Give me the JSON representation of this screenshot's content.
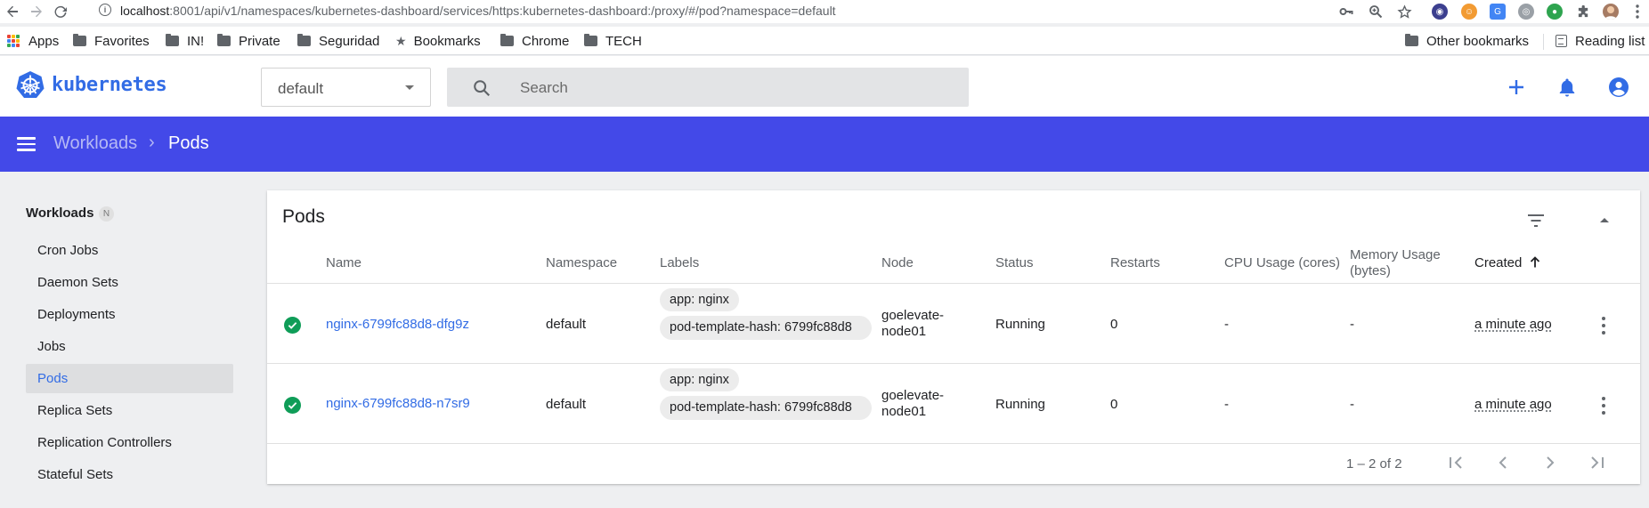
{
  "browser": {
    "url_host": "localhost",
    "url_rest": ":8001/api/v1/namespaces/kubernetes-dashboard/services/https:kubernetes-dashboard:/proxy/#/pod?namespace=default",
    "bookmarks": [
      "Apps",
      "Favorites",
      "IN!",
      "Private",
      "Seguridad",
      "Bookmarks",
      "Chrome",
      "TECH"
    ],
    "other_bookmarks": "Other bookmarks",
    "reading_list": "Reading list"
  },
  "app": {
    "logo_text": "kubernetes",
    "namespace": "default",
    "search_placeholder": "Search",
    "brand_color": "#326ce5",
    "header_color": "#4349e8"
  },
  "breadcrumb": {
    "parent": "Workloads",
    "separator": "›",
    "current": "Pods"
  },
  "sidebar": {
    "section_title": "Workloads",
    "section_badge": "N",
    "items": [
      {
        "label": "Cron Jobs",
        "active": false
      },
      {
        "label": "Daemon Sets",
        "active": false
      },
      {
        "label": "Deployments",
        "active": false
      },
      {
        "label": "Jobs",
        "active": false
      },
      {
        "label": "Pods",
        "active": true
      },
      {
        "label": "Replica Sets",
        "active": false
      },
      {
        "label": "Replication Controllers",
        "active": false
      },
      {
        "label": "Stateful Sets",
        "active": false
      }
    ]
  },
  "pods_card": {
    "title": "Pods",
    "columns": {
      "name": "Name",
      "namespace": "Namespace",
      "labels": "Labels",
      "node": "Node",
      "status": "Status",
      "restarts": "Restarts",
      "cpu": "CPU Usage (cores)",
      "memory": "Memory Usage (bytes)",
      "created": "Created",
      "created_sort_icon": "arrow-up-icon"
    },
    "rows": [
      {
        "status_icon": "check-circle-icon",
        "name": "nginx-6799fc88d8-dfg9z",
        "namespace": "default",
        "labels": [
          "app: nginx",
          "pod-template-hash: 6799fc88d8"
        ],
        "node": "goelevate-node01",
        "status": "Running",
        "restarts": "0",
        "cpu": "-",
        "memory": "-",
        "created": "a minute ago"
      },
      {
        "status_icon": "check-circle-icon",
        "name": "nginx-6799fc88d8-n7sr9",
        "namespace": "default",
        "labels": [
          "app: nginx",
          "pod-template-hash: 6799fc88d8"
        ],
        "node": "goelevate-node01",
        "status": "Running",
        "restarts": "0",
        "cpu": "-",
        "memory": "-",
        "created": "a minute ago"
      }
    ],
    "paginator": "1 – 2 of 2"
  }
}
